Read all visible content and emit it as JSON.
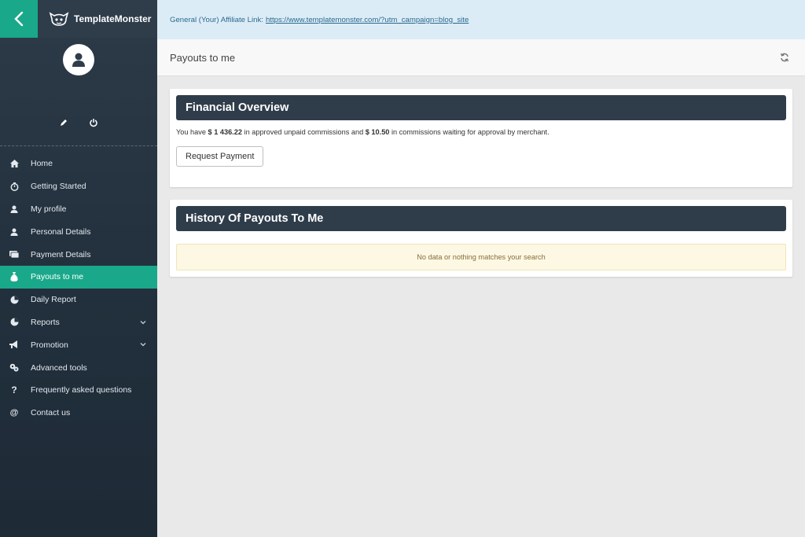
{
  "brand": {
    "name": "TemplateMonster"
  },
  "affiliate": {
    "label": "General (Your) Affiliate Link:",
    "link": "https://www.templatemonster.com/?utm_campaign=blog_site"
  },
  "page": {
    "title": "Payouts to me"
  },
  "financial": {
    "title": "Financial Overview",
    "text_1": "You have ",
    "approved": "$ 1 436.22",
    "text_2": " in approved unpaid commissions and ",
    "waiting": "$ 10.50",
    "text_3": " in commissions waiting for approval by merchant.",
    "button": "Request Payment"
  },
  "history": {
    "title": "History Of Payouts To Me",
    "empty": "No data or nothing matches your search"
  },
  "nav": [
    {
      "label": "Home",
      "icon": "home-icon"
    },
    {
      "label": "Getting Started",
      "icon": "stopwatch-icon"
    },
    {
      "label": "My profile",
      "icon": "user-icon"
    },
    {
      "label": "Personal Details",
      "icon": "user-icon"
    },
    {
      "label": "Payment Details",
      "icon": "card-icon"
    },
    {
      "label": "Payouts to me",
      "icon": "money-bag-icon",
      "active": true
    },
    {
      "label": "Daily Report",
      "icon": "pie-chart-icon"
    },
    {
      "label": "Reports",
      "icon": "pie-chart-icon",
      "expandable": true
    },
    {
      "label": "Promotion",
      "icon": "megaphone-icon",
      "expandable": true
    },
    {
      "label": "Advanced tools",
      "icon": "gears-icon"
    },
    {
      "label": "Frequently asked questions",
      "icon": "question-icon"
    },
    {
      "label": "Contact us",
      "icon": "at-icon"
    }
  ],
  "colors": {
    "accent": "#1aa88a",
    "sidebar": "#2d3b49",
    "header_bar": "#2f3d4b",
    "affiliate_bg": "#dcecf6"
  }
}
